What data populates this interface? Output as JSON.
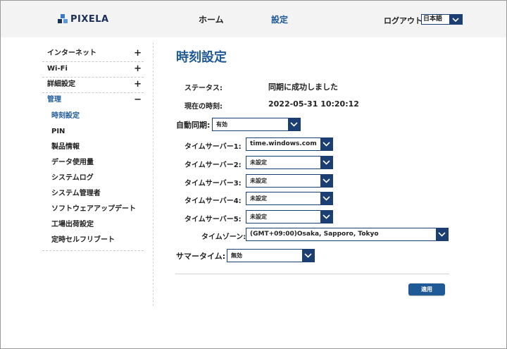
{
  "header": {
    "logo_text": "PIXELA",
    "nav_home": "ホーム",
    "nav_settings": "設定",
    "logout": "ログアウト",
    "language": "日本語"
  },
  "sidebar": {
    "sections": [
      {
        "label": "インターネット",
        "symbol": "+"
      },
      {
        "label": "Wi-Fi",
        "symbol": "+"
      },
      {
        "label": "詳細設定",
        "symbol": "+"
      },
      {
        "label": "管理",
        "symbol": "−"
      }
    ],
    "management_items": [
      "時刻設定",
      "PIN",
      "製品情報",
      "データ使用量",
      "システムログ",
      "システム管理者",
      "ソフトウェアアップデート",
      "工場出荷設定",
      "定時セルフリブート"
    ]
  },
  "main": {
    "title": "時刻設定",
    "status_label": "ステータス:",
    "status_value": "同期に成功しました",
    "current_time_label": "現在の時刻:",
    "current_time_value": "2022-05-31 10:20:12",
    "auto_sync_label": "自動同期:",
    "auto_sync_value": "有効",
    "time_servers": [
      {
        "label": "タイムサーバー1:",
        "value": "time.windows.com"
      },
      {
        "label": "タイムサーバー2:",
        "value": "未設定"
      },
      {
        "label": "タイムサーバー3:",
        "value": "未設定"
      },
      {
        "label": "タイムサーバー4:",
        "value": "未設定"
      },
      {
        "label": "タイムサーバー5:",
        "value": "未設定"
      }
    ],
    "timezone_label": "タイムゾーン:",
    "timezone_value": "(GMT+09:00)Osaka, Sapporo, Tokyo",
    "summer_time_label": "サマータイム:",
    "summer_time_value": "無効",
    "apply_label": "適用"
  },
  "colors": {
    "accent": "#1f5a96",
    "dropdown_button": "#1c3f73",
    "header_bg": "#f3f3f3"
  }
}
